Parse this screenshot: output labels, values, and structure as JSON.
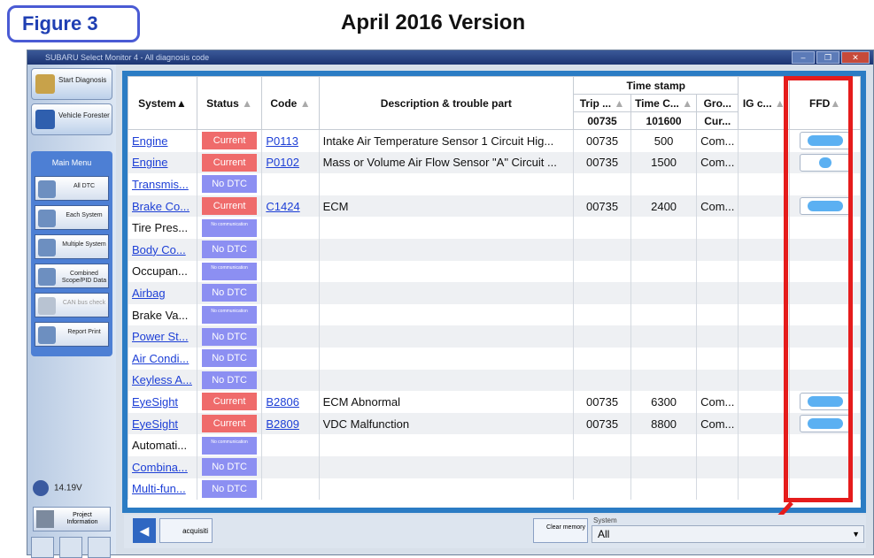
{
  "figure_label": "Figure 3",
  "version_title": "April 2016 Version",
  "window": {
    "title": "SUBARU Select Monitor 4 - All diagnosis code",
    "buttons": [
      "–",
      "❐",
      "✕"
    ]
  },
  "sidebar": {
    "start_diagnosis": "Start Diagnosis",
    "vehicle_forester": "Vehicle Forester",
    "main_menu_title": "Main Menu",
    "menu_items": [
      {
        "label": "All DTC",
        "enabled": true
      },
      {
        "label": "Each System",
        "enabled": true
      },
      {
        "label": "Multiple System",
        "enabled": true
      },
      {
        "label": "Combined Scope/PID Data",
        "enabled": true
      },
      {
        "label": "CAN bus check",
        "enabled": false
      },
      {
        "label": "Report Print",
        "enabled": true
      }
    ],
    "voltage": "14.19V",
    "project_information": "Project Information"
  },
  "table": {
    "headers": {
      "system": "System▲",
      "status": "Status",
      "code": "Code",
      "description": "Description & trouble part",
      "timestamp_group": "Time stamp",
      "trip": "Trip ...",
      "time": "Time C...",
      "group": "Gro...",
      "ig": "IG c...",
      "ffd": "FFD"
    },
    "subheaders": {
      "trip": "00735",
      "time": "101600",
      "group": "Cur..."
    },
    "rows": [
      {
        "system": "Engine",
        "link": true,
        "status": "Current",
        "code": "P0113",
        "description": "Intake Air Temperature Sensor 1 Circuit Hig...",
        "trip": "00735",
        "time": "500",
        "group": "Com...",
        "ffd": "multi"
      },
      {
        "system": "Engine",
        "link": true,
        "status": "Current",
        "code": "P0102",
        "description": "Mass or Volume Air Flow Sensor \"A\" Circuit ...",
        "trip": "00735",
        "time": "1500",
        "group": "Com...",
        "ffd": "single"
      },
      {
        "system": "Transmis...",
        "link": true,
        "status": "No DTC",
        "code": "",
        "description": "",
        "trip": "",
        "time": "",
        "group": "",
        "ffd": ""
      },
      {
        "system": "Brake Co...",
        "link": true,
        "status": "Current",
        "code": "C1424",
        "description": "ECM",
        "trip": "00735",
        "time": "2400",
        "group": "Com...",
        "ffd": "multi"
      },
      {
        "system": "Tire Pres...",
        "link": false,
        "status": "No communication",
        "code": "",
        "description": "",
        "trip": "",
        "time": "",
        "group": "",
        "ffd": ""
      },
      {
        "system": "Body Co...",
        "link": true,
        "status": "No DTC",
        "code": "",
        "description": "",
        "trip": "",
        "time": "",
        "group": "",
        "ffd": ""
      },
      {
        "system": "Occupan...",
        "link": false,
        "status": "No communication",
        "code": "",
        "description": "",
        "trip": "",
        "time": "",
        "group": "",
        "ffd": ""
      },
      {
        "system": "Airbag",
        "link": true,
        "status": "No DTC",
        "code": "",
        "description": "",
        "trip": "",
        "time": "",
        "group": "",
        "ffd": ""
      },
      {
        "system": "Brake Va...",
        "link": false,
        "status": "No communication",
        "code": "",
        "description": "",
        "trip": "",
        "time": "",
        "group": "",
        "ffd": ""
      },
      {
        "system": "Power St...",
        "link": true,
        "status": "No DTC",
        "code": "",
        "description": "",
        "trip": "",
        "time": "",
        "group": "",
        "ffd": ""
      },
      {
        "system": "Air Condi...",
        "link": true,
        "status": "No DTC",
        "code": "",
        "description": "",
        "trip": "",
        "time": "",
        "group": "",
        "ffd": ""
      },
      {
        "system": "Keyless A...",
        "link": true,
        "status": "No DTC",
        "code": "",
        "description": "",
        "trip": "",
        "time": "",
        "group": "",
        "ffd": ""
      },
      {
        "system": "EyeSight",
        "link": true,
        "status": "Current",
        "code": "B2806",
        "description": "ECM Abnormal",
        "trip": "00735",
        "time": "6300",
        "group": "Com...",
        "ffd": "multi"
      },
      {
        "system": "EyeSight",
        "link": true,
        "status": "Current",
        "code": "B2809",
        "description": "VDC Malfunction",
        "trip": "00735",
        "time": "8800",
        "group": "Com...",
        "ffd": "multi"
      },
      {
        "system": "Automati...",
        "link": false,
        "status": "No communication",
        "code": "",
        "description": "",
        "trip": "",
        "time": "",
        "group": "",
        "ffd": ""
      },
      {
        "system": "Combina...",
        "link": true,
        "status": "No DTC",
        "code": "",
        "description": "",
        "trip": "",
        "time": "",
        "group": "",
        "ffd": ""
      },
      {
        "system": "Multi-fun...",
        "link": true,
        "status": "No DTC",
        "code": "",
        "description": "",
        "trip": "",
        "time": "",
        "group": "",
        "ffd": ""
      }
    ]
  },
  "bottom_bar": {
    "acquisition": "acquisiti",
    "clear_memory": "Clear memory",
    "system_filter_label": "System",
    "system_filter_value": "All"
  }
}
